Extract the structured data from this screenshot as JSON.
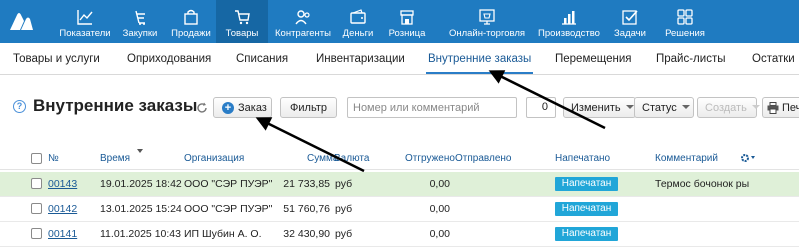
{
  "topnav": {
    "items": [
      {
        "label": "Показатели",
        "icon": "chart-line-icon"
      },
      {
        "label": "Закупки",
        "icon": "basket-icon"
      },
      {
        "label": "Продажи",
        "icon": "bag-icon"
      },
      {
        "label": "Товары",
        "icon": "cart-icon",
        "active": true
      },
      {
        "label": "Контрагенты",
        "icon": "people-icon"
      },
      {
        "label": "Деньги",
        "icon": "wallet-icon"
      },
      {
        "label": "Розница",
        "icon": "store-icon"
      },
      {
        "label": "Онлайн-торговля",
        "icon": "online-store-icon"
      },
      {
        "label": "Производство",
        "icon": "bar-chart-icon"
      },
      {
        "label": "Задачи",
        "icon": "checkbox-icon"
      },
      {
        "label": "Решения",
        "icon": "apps-icon"
      }
    ]
  },
  "subnav": {
    "items": [
      {
        "label": "Товары и услуги"
      },
      {
        "label": "Оприходования"
      },
      {
        "label": "Списания"
      },
      {
        "label": "Инвентаризации"
      },
      {
        "label": "Внутренние заказы",
        "active": true
      },
      {
        "label": "Перемещения"
      },
      {
        "label": "Прайс-листы"
      },
      {
        "label": "Остатки"
      }
    ]
  },
  "toolbar": {
    "help": "?",
    "title": "Внутренние заказы",
    "add_label": "Заказ",
    "filter_label": "Фильтр",
    "search_placeholder": "Номер или комментарий",
    "count": "0",
    "change_label": "Изменить",
    "status_label": "Статус",
    "create_label": "Создать",
    "print_label": "Печ"
  },
  "table": {
    "headers": {
      "number": "№",
      "time": "Время",
      "organization": "Организация",
      "sum": "Сумма",
      "currency": "Валюта",
      "shipped": "Отгружено",
      "sent": "Отправлено",
      "printed": "Напечатано",
      "comment": "Комментарий"
    },
    "rows": [
      {
        "number": "00143",
        "time": "19.01.2025 18:42",
        "organization": "ООО \"СЭР ПУЭР\"",
        "sum": "21 733,85",
        "currency": "руб",
        "shipped": "0,00",
        "printed": "Напечатан",
        "comment": "Термос бочонок ры"
      },
      {
        "number": "00142",
        "time": "13.01.2025 15:24",
        "organization": "ООО \"СЭР ПУЭР\"",
        "sum": "51 760,76",
        "currency": "руб",
        "shipped": "0,00",
        "printed": "Напечатан",
        "comment": ""
      },
      {
        "number": "00141",
        "time": "11.01.2025 10:43",
        "organization": "ИП Шубин А. О.",
        "sum": "32 430,90",
        "currency": "руб",
        "shipped": "0,00",
        "printed": "Напечатан",
        "comment": ""
      }
    ]
  },
  "colors": {
    "topbar": "#1f7bc1",
    "topbar_active": "#1667a4",
    "link": "#1a5a96",
    "badge": "#21a6d8",
    "selected_row": "#dff0d8",
    "arrow": "#000000"
  }
}
